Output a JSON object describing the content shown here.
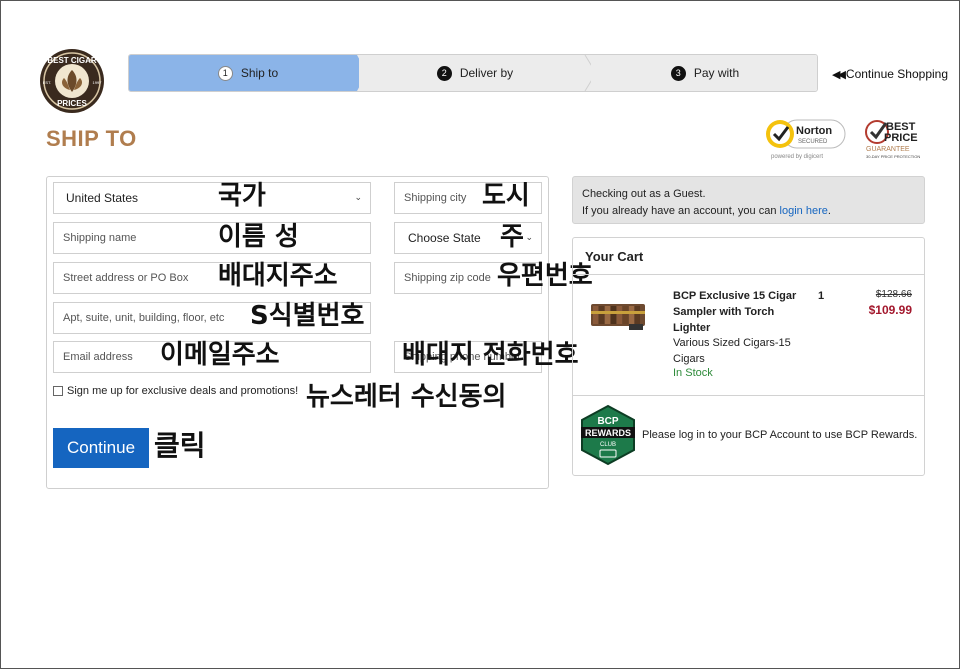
{
  "brand": {
    "logo_text_top": "BEST CIGAR",
    "logo_text_bottom": "PRICES",
    "logo_est": "EST.",
    "logo_year": "1997"
  },
  "stepper": {
    "steps": [
      {
        "num": "1",
        "label": "Ship to"
      },
      {
        "num": "2",
        "label": "Deliver by"
      },
      {
        "num": "3",
        "label": "Pay with"
      }
    ],
    "continue_shopping": "Continue Shopping"
  },
  "page_title": "SHIP TO",
  "badges": {
    "norton_top": "Norton",
    "norton_mid": "SECURED",
    "norton_bottom": "powered by digicert",
    "best_price_1": "BEST",
    "best_price_2": "PRICE",
    "best_price_3": "GUARANTEE",
    "best_price_4": "30-DAY PRICE PROTECTION"
  },
  "form": {
    "country_value": "United States",
    "shipping_city_placeholder": "Shipping city",
    "shipping_name_placeholder": "Shipping name",
    "state_value": "Choose State",
    "street_placeholder": "Street address or PO Box",
    "zip_placeholder": "Shipping zip code",
    "apt_placeholder": "Apt, suite, unit, building, floor, etc",
    "email_placeholder": "Email address",
    "phone_placeholder": "Shipping phone number",
    "signup_label": "Sign me up for exclusive deals and promotions!",
    "continue_label": "Continue"
  },
  "annotations": {
    "country": "국가",
    "city": "도시",
    "name": "이름 성",
    "state": "주",
    "street": "배대지주소",
    "zip": "우편번호",
    "apt": "S식별번호",
    "email": "이메일주소",
    "phone": "배대지 전화번호",
    "newsletter": "뉴스레터 수신동의",
    "click": "클릭"
  },
  "guest": {
    "line1": "Checking out as a Guest.",
    "line2_prefix": "If you already have an account, you can ",
    "login_link": "login here",
    "line2_suffix": "."
  },
  "cart": {
    "title": "Your Cart",
    "item": {
      "name": "BCP Exclusive 15 Cigar Sampler with Torch Lighter",
      "subtitle": "Various Sized Cigars-15 Cigars",
      "stock": "In Stock",
      "qty": "1",
      "price_old": "$128.66",
      "price_new": "$109.99"
    },
    "rewards_logo_1": "BCP",
    "rewards_logo_2": "REWARDS",
    "rewards_logo_3": "CLUB",
    "rewards_text": "Please log in to your BCP Account to use BCP Rewards."
  },
  "colors": {
    "accent_blue": "#1565c0",
    "step_active": "#8bb4e8",
    "title_brown": "#b07d4e",
    "price_red": "#a3182d",
    "stock_green": "#2e8b3a"
  }
}
